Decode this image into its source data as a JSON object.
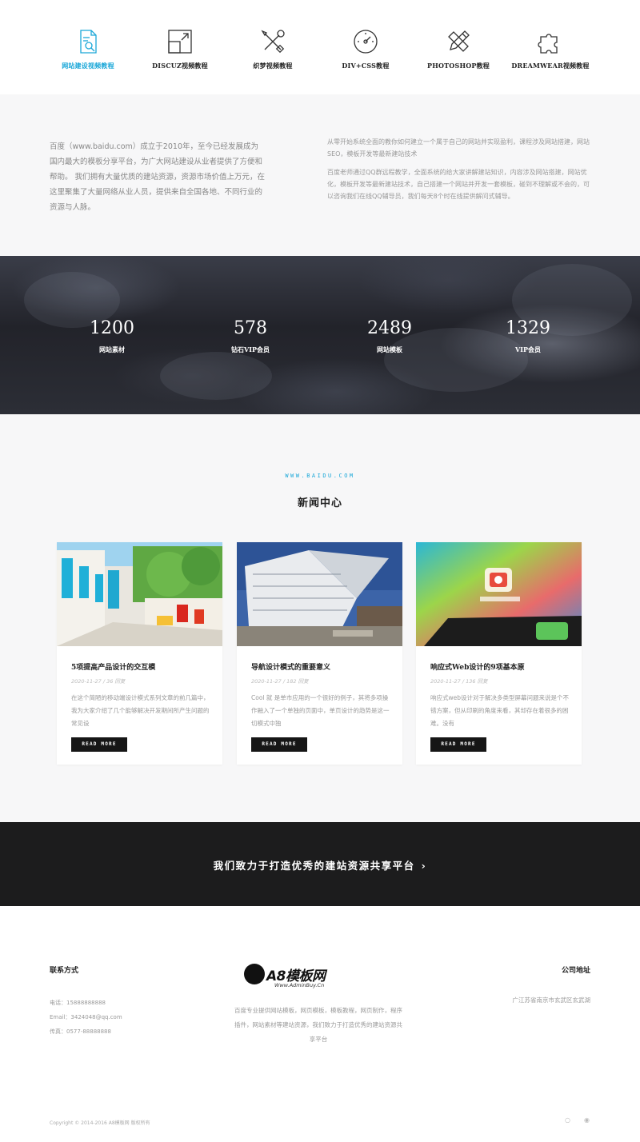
{
  "tabs": [
    {
      "label": "网站建设视频教程",
      "icon": "document-search-icon",
      "active": true
    },
    {
      "label": "DISCUZ视频教程",
      "icon": "expand-square-icon",
      "active": false
    },
    {
      "label": "织梦视频教程",
      "icon": "tools-icon",
      "active": false
    },
    {
      "label": "DIV+CSS教程",
      "icon": "gauge-icon",
      "active": false
    },
    {
      "label": "PHOTOSHOP教程",
      "icon": "pencil-ruler-icon",
      "active": false
    },
    {
      "label": "DREAMWEAR视频教程",
      "icon": "puzzle-icon",
      "active": false
    }
  ],
  "about": {
    "left_text": "百度（www.baidu.com）成立于2010年，至今已经发展成为国内最大的模板分享平台，为广大网站建设从业者提供了方便和帮助。 我们拥有大量优质的建站资源，资源市场价值上万元，在这里聚集了大量网络从业人员，提供来自全国各地、不同行业的资源与人脉。",
    "right_p1": "从零开始系统全面的教你如何建立一个属于自己的网站并实现盈利，课程涉及网站搭建，网站SEO，模板开发等最新建站技术",
    "right_p2": "百度老师通过QQ群远程教学，全面系统的给大家讲解建站知识，内容涉及网站搭建，网站优化，模板开发等最新建站技术，自己搭建一个网站并开发一套模板，碰到不理解或不会的，可以咨询我们在线QQ辅导员，我们每天8个时在线提供解问式辅导。"
  },
  "stats": [
    {
      "number": "1200",
      "caption": "网站素材"
    },
    {
      "number": "578",
      "caption": "钻石VIP会员"
    },
    {
      "number": "2489",
      "caption": "网站模板"
    },
    {
      "number": "1329",
      "caption": "VIP会员"
    }
  ],
  "news": {
    "eyebrow": "WWW.BAIDU.COM",
    "heading": "新闻中心",
    "cards": [
      {
        "title": "5项提高产品设计的交互模",
        "meta": "2020-11-27 / 36 回复",
        "excerpt": "在这个简陋的移动端设计模式系列文章的前几篇中，我为大家介绍了几个能够解决开发期间所产生问题的常见设",
        "button": "READ MORE"
      },
      {
        "title": "导航设计模式的重要意义",
        "meta": "2020-11-27 / 182 回复",
        "excerpt": "Cool 就 是单市应用的一个很好的例子，其将多项操作融入了一个单独的页面中，单页设计的趋势是这一切模式中独",
        "button": "READ MORE"
      },
      {
        "title": "响应式Web设计的9项基本原",
        "meta": "2020-11-27 / 136 回复",
        "excerpt": "响应式web设计对于解决多类型屏幕问题来说是个不错方案，但从印刷的角度来看，其却存在着很多的困难。没有",
        "button": "READ MORE"
      }
    ]
  },
  "cta": {
    "text": "我们致力于打造优秀的建站资源共享平台",
    "chevron": "›"
  },
  "footer": {
    "contact_title": "联系方式",
    "phone": "电话：15888888888",
    "email": "Email：3424048@qq.com",
    "fax": "传真：0577-88888888",
    "logo_name": "A8模板网",
    "logo_url": "Www.AdminBuy.Cn",
    "desc": "百度专业提供网站模板，网页模板，模板教程，网页制作，程序插件，网站素材等建站资源，我们致力于打造优秀的建站资源共享平台",
    "address_title": "公司地址",
    "address": "广江苏省南京市玄武区玄武湖",
    "copyright": "Copyright © 2014-2016 A8模板网 版权所有",
    "social_1": "○",
    "social_2": "◉"
  },
  "colors": {
    "accent": "#1aa7d8",
    "dark": "#1c1c1d",
    "light_bg": "#f7f7f8"
  }
}
